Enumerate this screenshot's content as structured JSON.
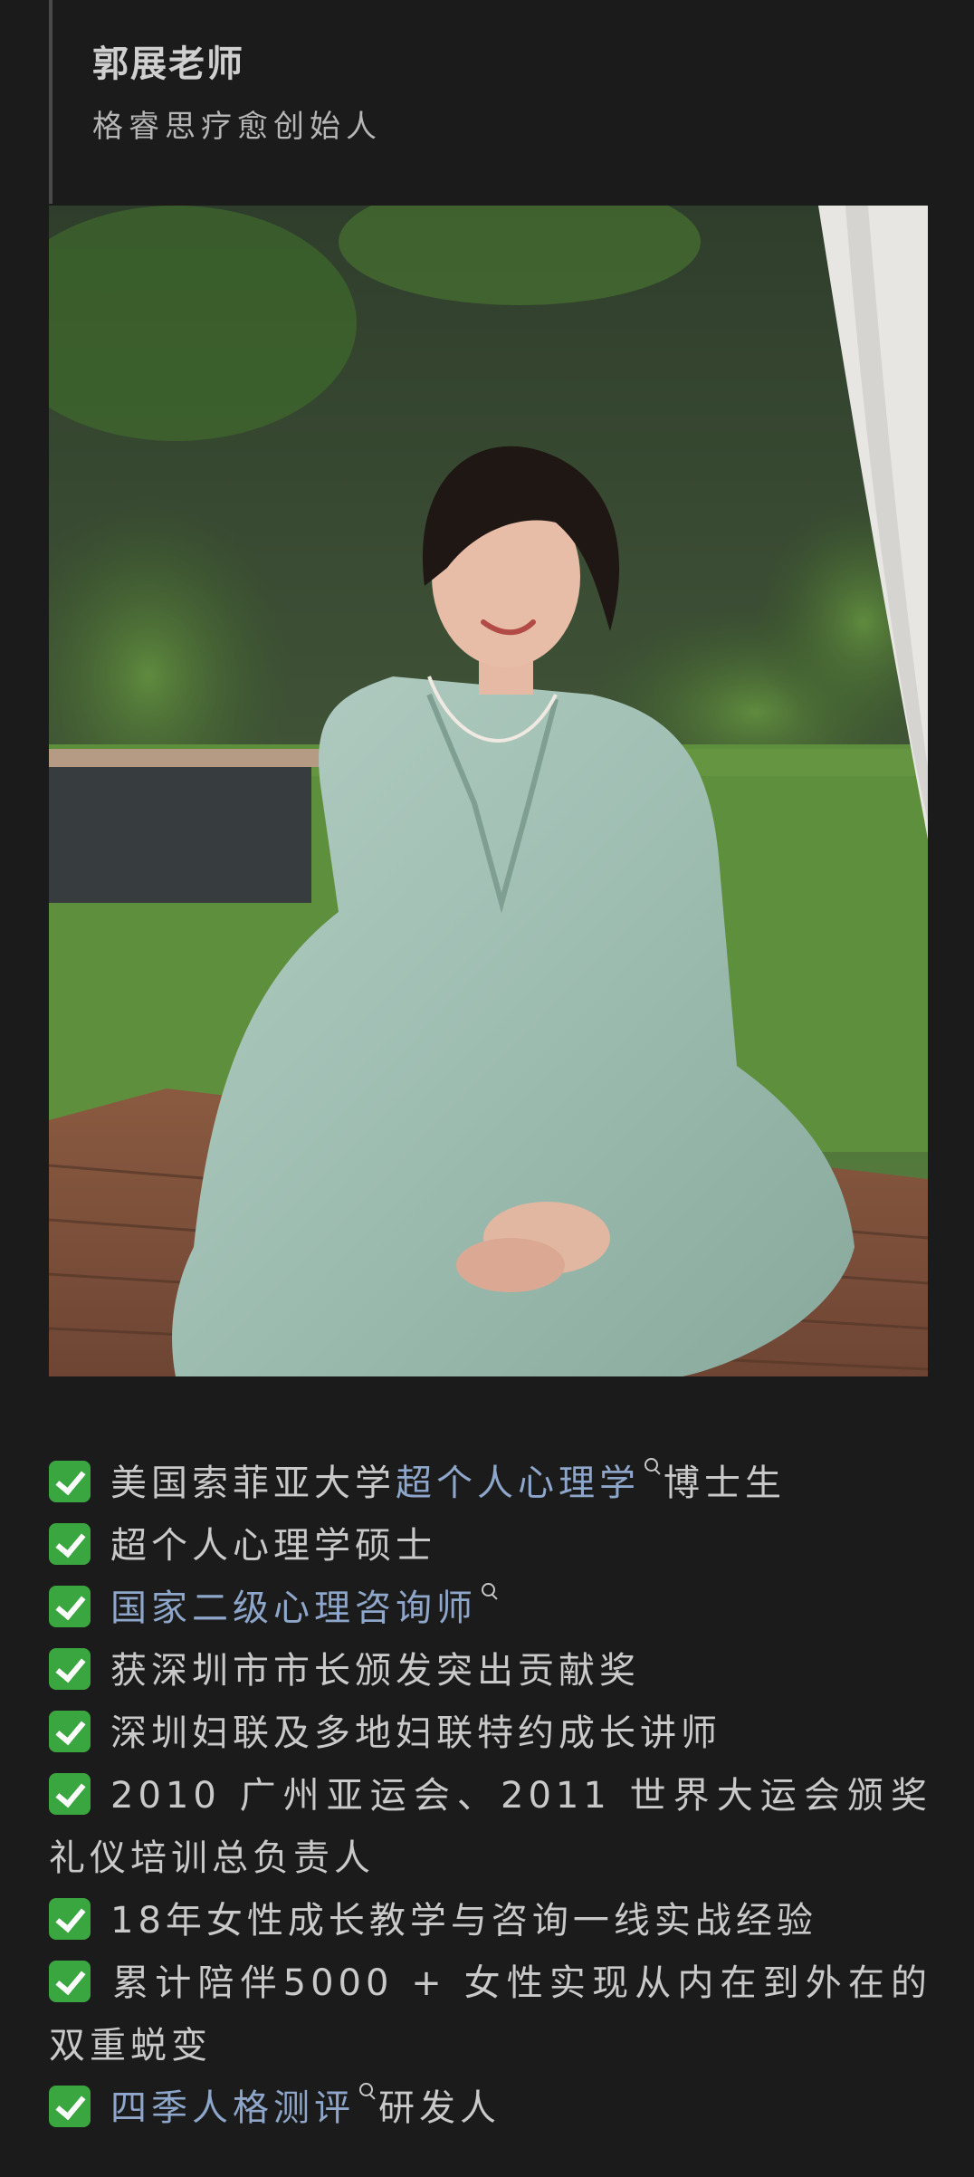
{
  "header": {
    "name": "郭展老师",
    "title": "格睿思疗愈创始人"
  },
  "photo": {
    "icon": "portrait-photo"
  },
  "credentials": [
    {
      "pre": "美国索菲亚大学",
      "link": "超个人心理学",
      "post": "博士生"
    },
    {
      "pre": "超个人心理学硕士",
      "link": "",
      "post": ""
    },
    {
      "pre": "",
      "link": "国家二级心理咨询师",
      "post": ""
    },
    {
      "pre": "获深圳市市长颁发突出贡献奖",
      "link": "",
      "post": ""
    },
    {
      "pre": "深圳妇联及多地妇联特约成长讲师",
      "link": "",
      "post": ""
    },
    {
      "pre": "2010 广州亚运会、2011 世界大运会颁奖礼仪培训总负责人",
      "link": "",
      "post": ""
    },
    {
      "pre": "18年女性成长教学与咨询一线实战经验",
      "link": "",
      "post": ""
    },
    {
      "pre": "累计陪伴5000 + 女性实现从内在到外在的双重蜕变",
      "link": "",
      "post": ""
    },
    {
      "pre": "",
      "link": "四季人格测评",
      "post": "研发人"
    }
  ],
  "colors": {
    "background": "#1b1b1c",
    "link": "#8ea6c9",
    "check": "#3aa63f"
  }
}
